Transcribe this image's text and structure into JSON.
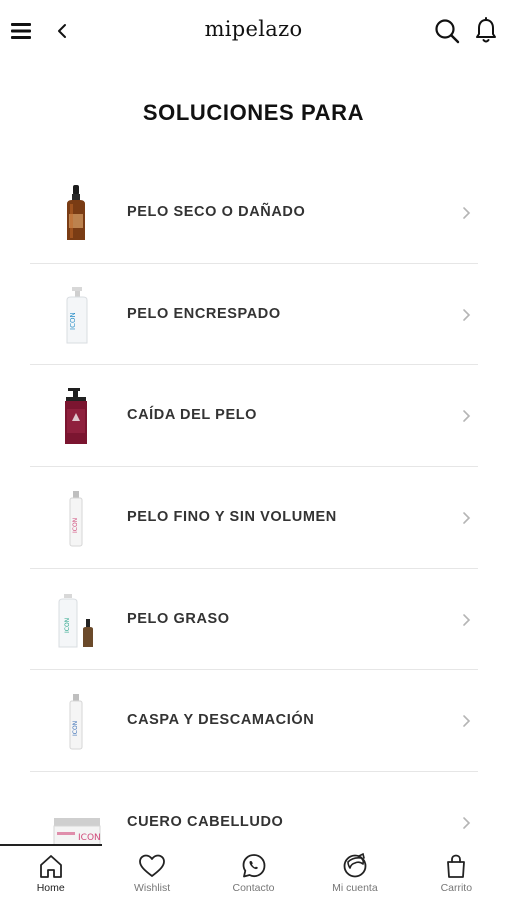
{
  "header": {
    "brand": "mipelazo",
    "menu_icon": "hamburger-menu-icon",
    "back_icon": "chevron-left-icon",
    "search_icon": "search-icon",
    "notifications_icon": "bell-icon"
  },
  "page": {
    "title": "SOLUCIONES PARA"
  },
  "categories": [
    {
      "label": "PELO SECO O DAÑADO",
      "image": "amber-dropper-bottle"
    },
    {
      "label": "PELO ENCRESPADO",
      "image": "white-pump-bottle"
    },
    {
      "label": "CAÍDA DEL PELO",
      "image": "burgundy-pump-bottle"
    },
    {
      "label": "PELO FINO Y SIN VOLUMEN",
      "image": "slim-white-bottle"
    },
    {
      "label": "PELO GRASO",
      "image": "bottle-and-dropper-set"
    },
    {
      "label": "CASPA Y DESCAMACIÓN",
      "image": "slim-white-bottle"
    },
    {
      "label": "CUERO CABELLUDO",
      "image": "hair-mask-jar"
    }
  ],
  "tabbar": {
    "active": "home",
    "items": [
      {
        "key": "home",
        "label": "Home",
        "icon": "home-icon"
      },
      {
        "key": "wishlist",
        "label": "Wishlist",
        "icon": "heart-icon"
      },
      {
        "key": "contacto",
        "label": "Contacto",
        "icon": "whatsapp-icon"
      },
      {
        "key": "cuenta",
        "label": "Mi cuenta",
        "icon": "account-icon"
      },
      {
        "key": "carrito",
        "label": "Carrito",
        "icon": "shopping-bag-icon"
      }
    ]
  },
  "colors": {
    "text": "#1a1a1a",
    "divider": "#e6e6e6",
    "chevron": "#b5b5b5",
    "tab_label": "#777777"
  }
}
